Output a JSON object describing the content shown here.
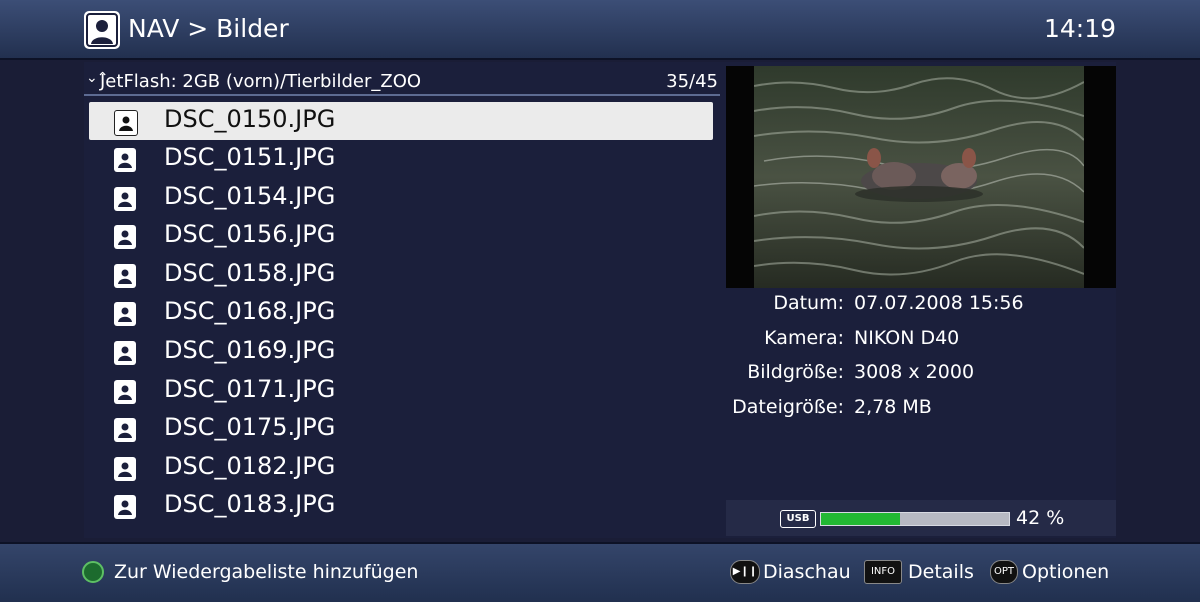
{
  "header": {
    "title": "NAV > Bilder",
    "clock": "14:19"
  },
  "browser": {
    "path": "JetFlash: 2GB (vorn)/Tierbilder_ZOO",
    "count": "35/45",
    "files": [
      "DSC_0150.JPG",
      "DSC_0151.JPG",
      "DSC_0154.JPG",
      "DSC_0156.JPG",
      "DSC_0158.JPG",
      "DSC_0168.JPG",
      "DSC_0169.JPG",
      "DSC_0171.JPG",
      "DSC_0175.JPG",
      "DSC_0182.JPG",
      "DSC_0183.JPG"
    ],
    "selected_index": 0
  },
  "info": [
    {
      "label": "Datum:",
      "value": "07.07.2008 15:56"
    },
    {
      "label": "Kamera:",
      "value": "NIKON D40"
    },
    {
      "label": "Bildgröße:",
      "value": "3008 x 2000"
    },
    {
      "label": "Dateigröße:",
      "value": "2,78 MB"
    }
  ],
  "storage": {
    "icon_text": "USB",
    "percent_text": "42 %",
    "fill_percent": 42
  },
  "footer": {
    "add_label": "Zur Wiedergabeliste hinzufügen",
    "slideshow_label": "Diaschau",
    "info_key": "INFO",
    "details_label": "Details",
    "opt_key": "OPT",
    "options_label": "Optionen"
  },
  "colors": {
    "accent_green": "#22b833",
    "background": "#1b1f3b",
    "selection": "#ebebeb"
  }
}
